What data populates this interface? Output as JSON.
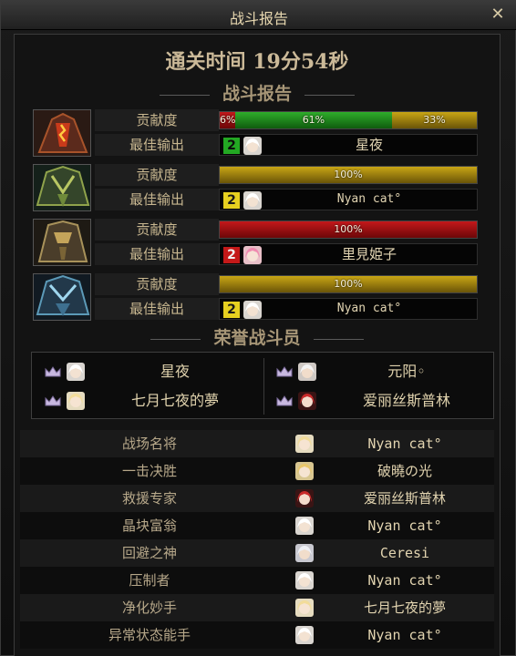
{
  "window": {
    "title": "战斗报告",
    "close_glyph": "✕"
  },
  "header": {
    "clear_time": "通关时间   19分54秒"
  },
  "battle_report": {
    "title": "战斗报告",
    "bosses": [
      {
        "icon": "red-armored-boss-icon",
        "contribution_label": "贡献度",
        "output_label": "最佳输出",
        "segments": [
          {
            "label": "6%",
            "value": 6,
            "color": "#b01416"
          },
          {
            "label": "61%",
            "value": 61,
            "color": "#23962a"
          },
          {
            "label": "33%",
            "value": 33,
            "color": "#b7950f"
          }
        ],
        "best_rank": "2",
        "best_rank_color": "green",
        "best_name": "星夜"
      },
      {
        "icon": "green-armored-boss-icon",
        "contribution_label": "贡献度",
        "output_label": "最佳输出",
        "segments": [
          {
            "label": "100%",
            "value": 100,
            "color": "#b7950f"
          }
        ],
        "best_rank": "2",
        "best_rank_color": "yellow",
        "best_name": "Nyan cat°"
      },
      {
        "icon": "bronze-armored-boss-icon",
        "contribution_label": "贡献度",
        "output_label": "最佳输出",
        "segments": [
          {
            "label": "100%",
            "value": 100,
            "color": "#b01416"
          }
        ],
        "best_rank": "2",
        "best_rank_color": "red",
        "best_name": "里見姫子"
      },
      {
        "icon": "blue-armored-boss-icon",
        "contribution_label": "贡献度",
        "output_label": "最佳输出",
        "segments": [
          {
            "label": "100%",
            "value": 100,
            "color": "#b7950f"
          }
        ],
        "best_rank": "2",
        "best_rank_color": "yellow",
        "best_name": "Nyan cat°"
      }
    ]
  },
  "honor": {
    "title": "荣誉战斗员",
    "members": [
      {
        "name": "星夜",
        "avatar": "white-hair-avatar"
      },
      {
        "name": "元阳◦",
        "avatar": "white-hair-avatar"
      },
      {
        "name": "七月七夜的夢",
        "avatar": "blonde-avatar"
      },
      {
        "name": "爱丽丝斯普林",
        "avatar": "red-hair-avatar"
      }
    ]
  },
  "awards": [
    {
      "title": "战场名将",
      "name": "Nyan cat°",
      "avatar": "blonde-avatar"
    },
    {
      "title": "一击决胜",
      "name": "破曉の光",
      "avatar": "blonde-avatar"
    },
    {
      "title": "救援专家",
      "name": "爱丽丝斯普林",
      "avatar": "red-hair-avatar"
    },
    {
      "title": "晶块富翁",
      "name": "Nyan cat°",
      "avatar": "white-hair-avatar"
    },
    {
      "title": "回避之神",
      "name": "Ceresi",
      "avatar": "white-hair-avatar"
    },
    {
      "title": "压制者",
      "name": "Nyan cat°",
      "avatar": "white-hair-avatar"
    },
    {
      "title": "净化妙手",
      "name": "七月七夜的夢",
      "avatar": "blonde-avatar"
    },
    {
      "title": "异常状态能手",
      "name": "Nyan cat°",
      "avatar": "white-hair-avatar"
    }
  ]
}
